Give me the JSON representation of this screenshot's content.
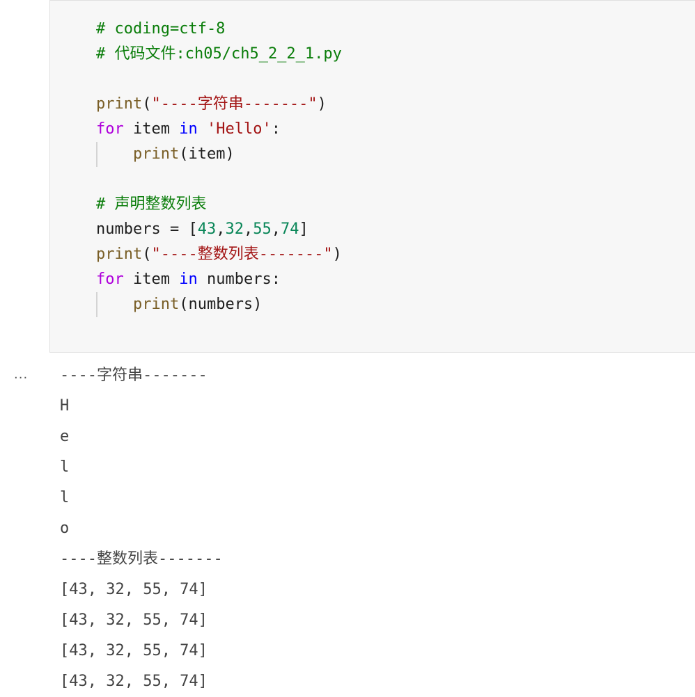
{
  "code_lines": [
    [
      {
        "cls": "tok-comment",
        "text": "# coding=ctf-8"
      }
    ],
    [
      {
        "cls": "tok-comment",
        "text": "# 代码文件:ch05/ch5_2_2_1.py"
      }
    ],
    [],
    [
      {
        "cls": "tok-fn",
        "text": "print"
      },
      {
        "cls": "tok-plain",
        "text": "("
      },
      {
        "cls": "tok-str",
        "text": "\"----字符串-------\""
      },
      {
        "cls": "tok-plain",
        "text": ")"
      }
    ],
    [
      {
        "cls": "tok-kw",
        "text": "for"
      },
      {
        "cls": "tok-plain",
        "text": " item "
      },
      {
        "cls": "tok-kw2",
        "text": "in"
      },
      {
        "cls": "tok-plain",
        "text": " "
      },
      {
        "cls": "tok-str",
        "text": "'Hello'"
      },
      {
        "cls": "tok-plain",
        "text": ":"
      }
    ],
    [
      {
        "cls": "tok-plain",
        "text": "    "
      },
      {
        "cls": "tok-fn",
        "text": "print"
      },
      {
        "cls": "tok-plain",
        "text": "(item)"
      }
    ],
    [],
    [
      {
        "cls": "tok-comment",
        "text": "# 声明整数列表"
      }
    ],
    [
      {
        "cls": "tok-plain",
        "text": "numbers = ["
      },
      {
        "cls": "tok-num",
        "text": "43"
      },
      {
        "cls": "tok-plain",
        "text": ","
      },
      {
        "cls": "tok-num",
        "text": "32"
      },
      {
        "cls": "tok-plain",
        "text": ","
      },
      {
        "cls": "tok-num",
        "text": "55"
      },
      {
        "cls": "tok-plain",
        "text": ","
      },
      {
        "cls": "tok-num",
        "text": "74"
      },
      {
        "cls": "tok-plain",
        "text": "]"
      }
    ],
    [
      {
        "cls": "tok-fn",
        "text": "print"
      },
      {
        "cls": "tok-plain",
        "text": "("
      },
      {
        "cls": "tok-str",
        "text": "\"----整数列表-------\""
      },
      {
        "cls": "tok-plain",
        "text": ")"
      }
    ],
    [
      {
        "cls": "tok-kw",
        "text": "for"
      },
      {
        "cls": "tok-plain",
        "text": " item "
      },
      {
        "cls": "tok-kw2",
        "text": "in"
      },
      {
        "cls": "tok-plain",
        "text": " numbers:"
      }
    ],
    [
      {
        "cls": "tok-plain",
        "text": "    "
      },
      {
        "cls": "tok-fn",
        "text": "print"
      },
      {
        "cls": "tok-plain",
        "text": "(numbers)"
      }
    ]
  ],
  "output": {
    "indicator": "...",
    "lines": [
      "----字符串-------",
      "H",
      "e",
      "l",
      "l",
      "o",
      "----整数列表-------",
      "[43, 32, 55, 74]",
      "[43, 32, 55, 74]",
      "[43, 32, 55, 74]",
      "[43, 32, 55, 74]"
    ]
  }
}
